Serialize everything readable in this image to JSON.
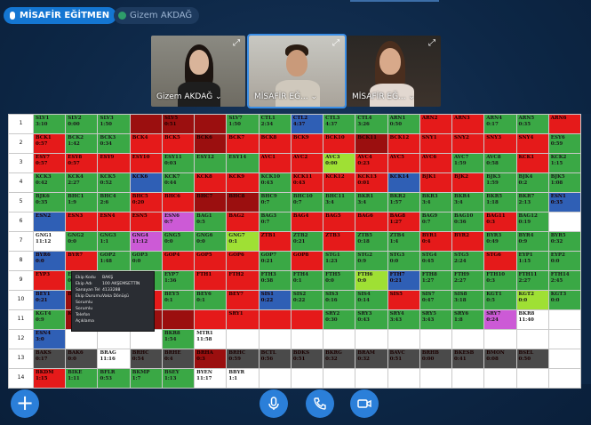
{
  "topbar": {
    "presenter_label": "MİSAFİR EĞİTMEN",
    "participant_label": "Gizem AKDAĞ"
  },
  "tiles": [
    {
      "name": "Gizem AKDAĞ ⌄"
    },
    {
      "name": "MİSAFİR EĞ... ⌄"
    },
    {
      "name": "MİSAFİR EĞ... ⌄"
    }
  ],
  "sheet": {
    "row_numbers": [
      "1",
      "2",
      "3",
      "4",
      "5",
      "6",
      "7",
      "8",
      "9",
      "10",
      "11",
      "12",
      "13",
      "14"
    ],
    "rows": [
      [
        [
          "SLV1",
          "3:10",
          "g"
        ],
        [
          "SLV2",
          "0:00",
          "g"
        ],
        [
          "SLV3",
          "1:50",
          "g"
        ],
        [
          "",
          "",
          "dr"
        ],
        [
          "SLV5",
          "0:51",
          "dr"
        ],
        [
          "",
          "",
          "dr"
        ],
        [
          "SLV7",
          "1:50",
          "g"
        ],
        [
          "CTL1",
          "2:34",
          "g"
        ],
        [
          "CTL2",
          "4:37",
          "b"
        ],
        [
          "CTL3",
          "4:37",
          "g"
        ],
        [
          "CTL4",
          "3:26",
          "g"
        ],
        [
          "ARN1",
          "0:50",
          "g"
        ],
        [
          "ARN2",
          "",
          "r"
        ],
        [
          "ARN3",
          "",
          "r"
        ],
        [
          "ARN4",
          "0:17",
          "g"
        ],
        [
          "ARN5",
          "0:35",
          "g"
        ],
        [
          "ARN6",
          "",
          "r"
        ]
      ],
      [
        [
          "BCK1",
          "0:57",
          "r"
        ],
        [
          "BCK2",
          "1:42",
          "g"
        ],
        [
          "BCK3",
          "0:34",
          "g"
        ],
        [
          "BCK4",
          "",
          "r"
        ],
        [
          "BCK5",
          "",
          "r"
        ],
        [
          "BCK6",
          "",
          "dr"
        ],
        [
          "BCK7",
          "",
          "r"
        ],
        [
          "BCK8",
          "",
          "r"
        ],
        [
          "BCK9",
          "",
          "r"
        ],
        [
          "BCK10",
          "",
          "r"
        ],
        [
          "BCK11",
          "",
          "dr"
        ],
        [
          "BCK12",
          "",
          "r"
        ],
        [
          "SNY1",
          "",
          "r"
        ],
        [
          "SNY2",
          "",
          "r"
        ],
        [
          "SNY3",
          "",
          "r"
        ],
        [
          "SNY4",
          "",
          "r"
        ],
        [
          "ESY6",
          "0:59",
          "g"
        ]
      ],
      [
        [
          "ESY7",
          "0:57",
          "r"
        ],
        [
          "ESY8",
          "0:57",
          "r"
        ],
        [
          "ESY9",
          "",
          "r"
        ],
        [
          "ESY10",
          "",
          "r"
        ],
        [
          "ESY11",
          "0:03",
          "g"
        ],
        [
          "ESY12",
          "",
          "g"
        ],
        [
          "ESY14",
          "",
          "g"
        ],
        [
          "AVC1",
          "",
          "r"
        ],
        [
          "AVC2",
          "",
          "r"
        ],
        [
          "AVC3",
          "0:00",
          "y"
        ],
        [
          "AVC4",
          "0:23",
          "r"
        ],
        [
          "AVC5",
          "",
          "r"
        ],
        [
          "AVC6",
          "",
          "r"
        ],
        [
          "AVC7",
          "1:59",
          "g"
        ],
        [
          "AVC8",
          "0:58",
          "g"
        ],
        [
          "KCK1",
          "",
          "r"
        ],
        [
          "KCK2",
          "1:15",
          "g"
        ]
      ],
      [
        [
          "KCK3",
          "0:42",
          "g"
        ],
        [
          "KCK4",
          "2:27",
          "g"
        ],
        [
          "KCK5",
          "0:52",
          "g"
        ],
        [
          "KCK6",
          "",
          "b"
        ],
        [
          "KCK7",
          "0:44",
          "g"
        ],
        [
          "KCK8",
          "",
          "r"
        ],
        [
          "KCK9",
          "",
          "r"
        ],
        [
          "KCK10",
          "0:43",
          "g"
        ],
        [
          "KCK11",
          "0:43",
          "r"
        ],
        [
          "KCK12",
          "",
          "r"
        ],
        [
          "KCK13",
          "0:01",
          "r"
        ],
        [
          "KCK14",
          "",
          "b"
        ],
        [
          "BJK1",
          "",
          "r"
        ],
        [
          "BJK2",
          "",
          "r"
        ],
        [
          "BJK3",
          "1:59",
          "g"
        ],
        [
          "BJK4",
          "0:2",
          "g"
        ],
        [
          "BJK5",
          "1:08",
          "g"
        ]
      ],
      [
        [
          "BJK6",
          "0:35",
          "g"
        ],
        [
          "BHC1",
          "1:9",
          "g"
        ],
        [
          "BHC4",
          "2:6",
          "g"
        ],
        [
          "BHC5",
          "0:20",
          "r"
        ],
        [
          "BHC6",
          "",
          "r"
        ],
        [
          "BHC7",
          "",
          "dr"
        ],
        [
          "BHC8",
          "",
          "dr"
        ],
        [
          "BHC9",
          "0:7",
          "g"
        ],
        [
          "BHC10",
          "0:7",
          "g"
        ],
        [
          "BHC11",
          "3:4",
          "g"
        ],
        [
          "BKR1",
          "3:4",
          "g"
        ],
        [
          "BKR2",
          "1:57",
          "g"
        ],
        [
          "BKR3",
          "3:4",
          "g"
        ],
        [
          "BKR4",
          "3:4",
          "g"
        ],
        [
          "BKR5",
          "1:18",
          "g"
        ],
        [
          "BKR7",
          "2:13",
          "g"
        ],
        [
          "ESN1",
          "0:35",
          "b"
        ]
      ],
      [
        [
          "ESN2",
          "",
          "b"
        ],
        [
          "ESN3",
          "",
          "r"
        ],
        [
          "ESN4",
          "",
          "r"
        ],
        [
          "ESN5",
          "",
          "r"
        ],
        [
          "ESN6",
          "0:7",
          "pk"
        ],
        [
          "BAG1",
          "0:5",
          "g"
        ],
        [
          "BAG2",
          "",
          "r"
        ],
        [
          "BAG3",
          "0:7",
          "g"
        ],
        [
          "BAG4",
          "",
          "r"
        ],
        [
          "BAG5",
          "",
          "r"
        ],
        [
          "BAG6",
          "",
          "r"
        ],
        [
          "BAG8",
          "1:27",
          "r"
        ],
        [
          "BAG9",
          "0:7",
          "g"
        ],
        [
          "BAG10",
          "0:36",
          "g"
        ],
        [
          "BAG11",
          "0:3",
          "r"
        ],
        [
          "BAG12",
          "0:19",
          "g"
        ],
        [
          "",
          "",
          "w"
        ]
      ],
      [
        [
          "GNG1",
          "11:12",
          "w"
        ],
        [
          "GNG2",
          "0:0",
          "g"
        ],
        [
          "GNG3",
          "1:1",
          "g"
        ],
        [
          "GNG4",
          "11:12",
          "pk"
        ],
        [
          "GNG5",
          "0:0",
          "g"
        ],
        [
          "GNG6",
          "0:0",
          "g"
        ],
        [
          "GNG7",
          "0:1",
          "y"
        ],
        [
          "ZTB1",
          "",
          "r"
        ],
        [
          "ZTB2",
          "0:21",
          "g"
        ],
        [
          "ZTB3",
          "",
          "r"
        ],
        [
          "ZTB5",
          "0:18",
          "g"
        ],
        [
          "ZTB4",
          "1:4",
          "g"
        ],
        [
          "BYR1",
          "0:4",
          "r"
        ],
        [
          "BYR2",
          "",
          "r"
        ],
        [
          "BYR3",
          "0:49",
          "g"
        ],
        [
          "BYR4",
          "0:9",
          "g"
        ],
        [
          "BYR5",
          "0:32",
          "g"
        ]
      ],
      [
        [
          "BYR6",
          "0:0",
          "b"
        ],
        [
          "BYR7",
          "",
          "r"
        ],
        [
          "GOP2",
          "1:48",
          "g"
        ],
        [
          "GOP3",
          "0:0",
          "g"
        ],
        [
          "GOP4",
          "",
          "r"
        ],
        [
          "GOP5",
          "",
          "r"
        ],
        [
          "GOP6",
          "",
          "r"
        ],
        [
          "GOP7",
          "0:21",
          "g"
        ],
        [
          "GOP8",
          "",
          "r"
        ],
        [
          "STG1",
          "1:23",
          "g"
        ],
        [
          "STG2",
          "0:9",
          "g"
        ],
        [
          "STG3",
          "0:0",
          "g"
        ],
        [
          "STG4",
          "0:45",
          "g"
        ],
        [
          "STG5",
          "2:24",
          "g"
        ],
        [
          "STG6",
          "",
          "r"
        ],
        [
          "EYP1",
          "1:15",
          "g"
        ],
        [
          "EYP2",
          "0:0",
          "g"
        ]
      ],
      [
        [
          "EYP3",
          "",
          "r"
        ],
        [
          "EYP4",
          "0:05",
          "g"
        ],
        [
          "EYP5",
          "",
          "r"
        ],
        [
          "EYP6",
          "0:34",
          "g"
        ],
        [
          "EYP7",
          "1:36",
          "g"
        ],
        [
          "FTH1",
          "",
          "r"
        ],
        [
          "FTH2",
          "",
          "r"
        ],
        [
          "FTH3",
          "0:38",
          "g"
        ],
        [
          "FTH4",
          "0:1",
          "g"
        ],
        [
          "FTH5",
          "0:0",
          "g"
        ],
        [
          "FTH6",
          "0:0",
          "y"
        ],
        [
          "FTH7",
          "0:21",
          "b"
        ],
        [
          "FTH8",
          "1:27",
          "g"
        ],
        [
          "FTH9",
          "2:27",
          "g"
        ],
        [
          "FTH10",
          "0:3",
          "g"
        ],
        [
          "FTH11",
          "2:27",
          "g"
        ],
        [
          "FTH14",
          "2:45",
          "g"
        ]
      ],
      [
        [
          "BEY1",
          "0:21",
          "b"
        ],
        [
          "BEY2",
          "",
          "dr"
        ],
        [
          "BEY3",
          "",
          "dr"
        ],
        [
          "",
          "",
          "r"
        ],
        [
          "BEY5",
          "0:1",
          "g"
        ],
        [
          "BEY6",
          "0:1",
          "g"
        ],
        [
          "BEY7",
          "",
          "r"
        ],
        [
          "SIS1",
          "0:22",
          "b"
        ],
        [
          "SIS2",
          "0:22",
          "g"
        ],
        [
          "SIS3",
          "0:16",
          "g"
        ],
        [
          "SIS4",
          "0:14",
          "g"
        ],
        [
          "SIS5",
          "",
          "r"
        ],
        [
          "SIS7",
          "0:47",
          "g"
        ],
        [
          "SIS8",
          "3:18",
          "g"
        ],
        [
          "KGT1",
          "0:5",
          "g"
        ],
        [
          "KGT2",
          "0:0",
          "y"
        ],
        [
          "KGT3",
          "0:0",
          "g"
        ]
      ],
      [
        [
          "KGT4",
          "0:9",
          "g"
        ],
        [
          "KGT5",
          "",
          "dr"
        ],
        [
          "",
          "",
          "dr"
        ],
        [
          "",
          "",
          "dr"
        ],
        [
          "",
          "",
          "dr"
        ],
        [
          "",
          "",
          "r"
        ],
        [
          "SRY1",
          "",
          "r"
        ],
        [
          "",
          "",
          "r"
        ],
        [
          "",
          "",
          "r"
        ],
        [
          "SRY2",
          "0:30",
          "g"
        ],
        [
          "SRY3",
          "0:43",
          "g"
        ],
        [
          "SRY4",
          "3:43",
          "g"
        ],
        [
          "SRY5",
          "3:43",
          "g"
        ],
        [
          "SRY6",
          "1:8",
          "g"
        ],
        [
          "SRY7",
          "0:24",
          "pk"
        ],
        [
          "BKR8",
          "11:40",
          "w"
        ],
        [
          "",
          "",
          "w"
        ]
      ],
      [
        [
          "ESN4",
          "3:0",
          "b"
        ],
        [
          "",
          "",
          "w"
        ],
        [
          "",
          "",
          "w"
        ],
        [
          "",
          "",
          "w"
        ],
        [
          "BKR8",
          "1:54",
          "g"
        ],
        [
          "MTR1",
          "11:58",
          "w"
        ],
        [
          "",
          "",
          "w"
        ],
        [
          "",
          "",
          "w"
        ],
        [
          "",
          "",
          "w"
        ],
        [
          "",
          "",
          "w"
        ],
        [
          "",
          "",
          "w"
        ],
        [
          "",
          "",
          "w"
        ],
        [
          "",
          "",
          "w"
        ],
        [
          "",
          "",
          "w"
        ],
        [
          "",
          "",
          "w"
        ],
        [
          "",
          "",
          "w"
        ],
        [
          "",
          "",
          "w"
        ]
      ],
      [
        [
          "BAKS",
          "0:17",
          "dk"
        ],
        [
          "BAK6",
          "0:0",
          "dk"
        ],
        [
          "BRAG",
          "11:16",
          "w"
        ],
        [
          "BRHC",
          "0:54",
          "dk"
        ],
        [
          "BRHE",
          "0:4",
          "dk"
        ],
        [
          "BRHA",
          "0:3",
          "dr"
        ],
        [
          "BRHC",
          "0:59",
          "dk"
        ],
        [
          "BCTL",
          "0:56",
          "dk"
        ],
        [
          "BDKS",
          "0:51",
          "dk"
        ],
        [
          "BKRG",
          "0:32",
          "dk"
        ],
        [
          "BRAM",
          "0:32",
          "dk"
        ],
        [
          "BAVC",
          "0:51",
          "dk"
        ],
        [
          "BRHB",
          "0:00",
          "dk"
        ],
        [
          "BKESB",
          "0:41",
          "dk"
        ],
        [
          "BMON",
          "0:08",
          "dk"
        ],
        [
          "BSEL",
          "0:50",
          "dk"
        ],
        [
          "",
          "",
          "w"
        ]
      ],
      [
        [
          "BKDM",
          "1:15",
          "r"
        ],
        [
          "BIKE",
          "1:11",
          "g"
        ],
        [
          "BFLR",
          "0:53",
          "g"
        ],
        [
          "BKMP",
          "1:7",
          "g"
        ],
        [
          "BSEY",
          "1:13",
          "g"
        ],
        [
          "BYEN",
          "11:17",
          "w"
        ],
        [
          "BBYR",
          "1:1",
          "w"
        ],
        [
          "",
          "",
          "w"
        ],
        [
          "",
          "",
          "w"
        ],
        [
          "",
          "",
          "w"
        ],
        [
          "",
          "",
          "w"
        ],
        [
          "",
          "",
          "w"
        ],
        [
          "",
          "",
          "w"
        ],
        [
          "",
          "",
          "w"
        ],
        [
          "",
          "",
          "w"
        ],
        [
          "",
          "",
          "w"
        ],
        [
          "",
          "",
          "w"
        ]
      ]
    ]
  },
  "context_menu": [
    [
      "Ekip Kodu",
      "BAKŞ"
    ],
    [
      "Ekip Adı",
      "100 AKŞEMSETTİN"
    ],
    [
      "Sanayan Tel",
      "4133288"
    ],
    [
      "Ekip Durumu",
      "Vaka Dönüşü"
    ],
    [
      "Sorumlu",
      ""
    ],
    [
      "Sorumlu Telefon",
      ""
    ],
    [
      "Açıklama",
      ""
    ]
  ],
  "controls": {
    "add_symbol": "+"
  },
  "colors": {
    "g": "#3aa845",
    "r": "#e51a1a",
    "dr": "#9b0f0f",
    "b": "#2f5fb5",
    "y": "#9fe034",
    "pk": "#cc5ad6",
    "w": "#ffffff",
    "dk": "#4a4a4a"
  }
}
